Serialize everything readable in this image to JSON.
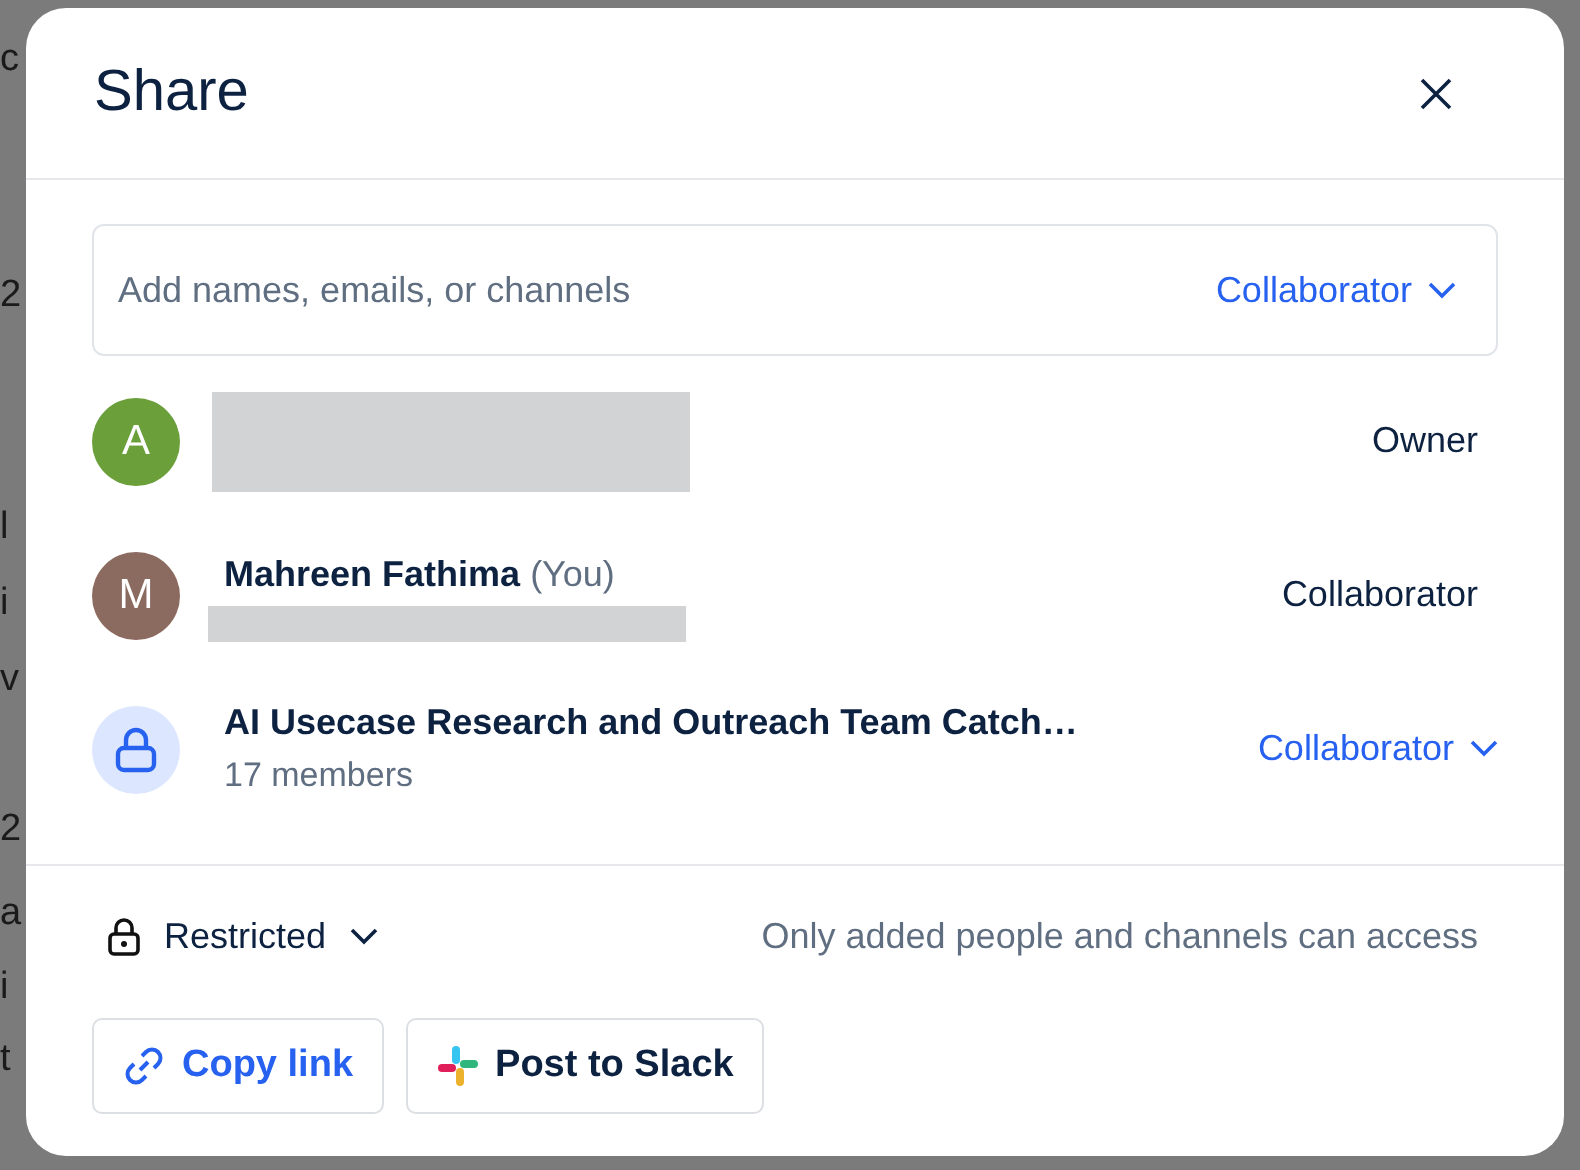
{
  "background": {
    "left_fragments": [
      "c",
      "2",
      "l",
      "i",
      "v",
      "2",
      "a",
      "i",
      "t"
    ]
  },
  "dialog": {
    "title": "Share"
  },
  "invite": {
    "placeholder": "Add names, emails, or channels",
    "role": "Collaborator"
  },
  "members": [
    {
      "kind": "person",
      "initial": "A",
      "color": "#6a9f3a",
      "name_redacted": true,
      "role": "Owner",
      "role_menu": false
    },
    {
      "kind": "person",
      "initial": "M",
      "color": "#8b6a5f",
      "name": "Mahreen Fathima",
      "you_label": "(You)",
      "email_redacted": true,
      "role": "Collaborator",
      "role_menu": false
    },
    {
      "kind": "channel",
      "name": "AI Usecase Research and Outreach Team Catch…",
      "subtitle": "17 members",
      "role": "Collaborator",
      "role_menu": true
    }
  ],
  "access": {
    "label": "Restricted",
    "description": "Only added people and channels can access"
  },
  "buttons": [
    {
      "kind": "copy",
      "label": "Copy link"
    },
    {
      "kind": "slack",
      "label": "Post to Slack"
    }
  ]
}
